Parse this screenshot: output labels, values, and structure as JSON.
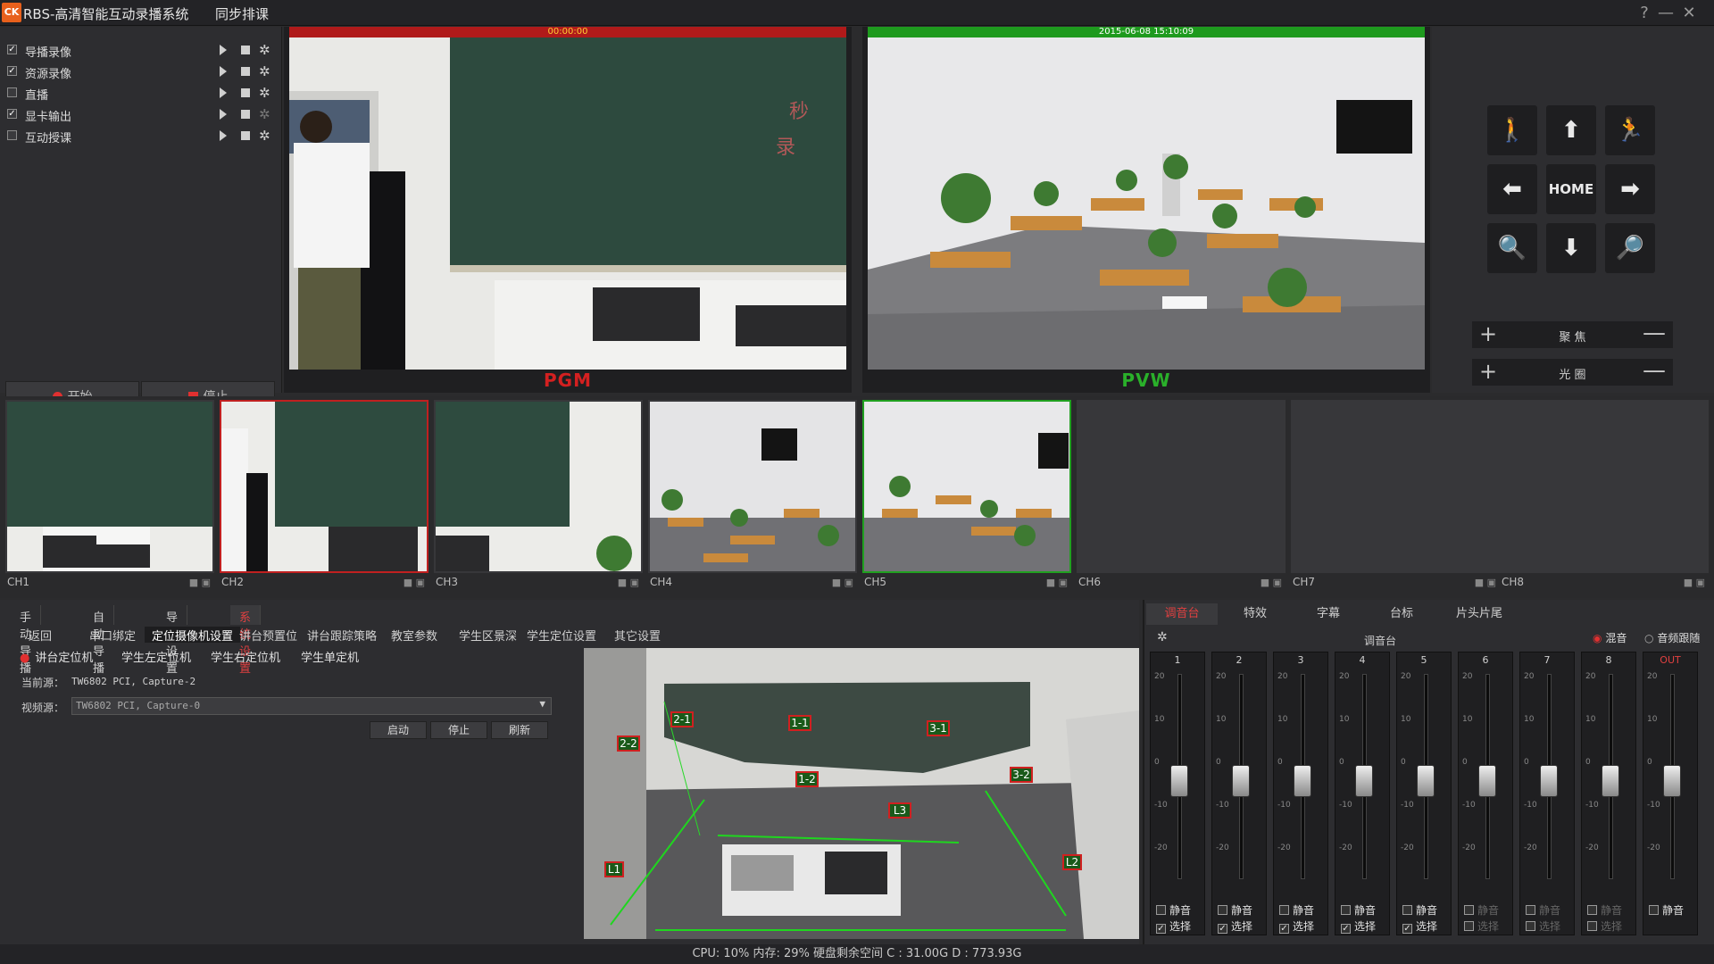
{
  "app": {
    "logo": "CK",
    "title": "RBS-高清智能互动录播系统",
    "menu_sync": "同步排课",
    "help": "?",
    "minimize": "—",
    "close": "✕"
  },
  "recording_panel": {
    "items": [
      {
        "label": "导播录像",
        "checked": true
      },
      {
        "label": "资源录像",
        "checked": true
      },
      {
        "label": "直播",
        "checked": false
      },
      {
        "label": "显卡输出",
        "checked": true
      },
      {
        "label": "互动授课",
        "checked": false
      }
    ],
    "start_label": "开始",
    "stop_label": "停止"
  },
  "pgm": {
    "timecode": "00:00:00",
    "label": "PGM",
    "color": "#cc2020"
  },
  "pvw": {
    "timestamp": "2015-06-08  15:10:09",
    "label": "PVW",
    "color": "#2aa82a"
  },
  "ptz": {
    "home_label": "HOME",
    "focus_label": "聚 焦",
    "iris_label": "光 圈",
    "plus": "+",
    "minus": "—"
  },
  "channels": [
    {
      "name": "CH1",
      "scene": "board"
    },
    {
      "name": "CH2",
      "scene": "teacher",
      "state": "pgm"
    },
    {
      "name": "CH3",
      "scene": "board2"
    },
    {
      "name": "CH4",
      "scene": "room"
    },
    {
      "name": "CH5",
      "scene": "room",
      "state": "pvw"
    },
    {
      "name": "CH6",
      "scene": "empty"
    },
    {
      "name": "CH7",
      "scene": "empty"
    },
    {
      "name": "CH8",
      "scene": "empty"
    }
  ],
  "main_tabs": [
    {
      "label": "手动导播",
      "active": false
    },
    {
      "label": "自动导播",
      "active": false
    },
    {
      "label": "导播设置",
      "active": false
    },
    {
      "label": "系统设置",
      "active": true
    }
  ],
  "sub_tabs": [
    {
      "label": "返回",
      "active": false
    },
    {
      "label": "串口绑定",
      "active": false
    },
    {
      "label": "定位摄像机设置",
      "active": true
    },
    {
      "label": "讲台预置位",
      "active": false
    },
    {
      "label": "讲台跟踪策略",
      "active": false
    },
    {
      "label": "教室参数",
      "active": false
    },
    {
      "label": "学生区景深",
      "active": false
    },
    {
      "label": "学生定位设置",
      "active": false
    },
    {
      "label": "其它设置",
      "active": false
    }
  ],
  "locator": {
    "options": [
      "讲台定位机",
      "学生左定位机",
      "学生右定位机",
      "学生单定机"
    ],
    "current_source_label": "当前源：",
    "current_source_value": "TW6802 PCI, Capture-2",
    "video_source_label": "视频源：",
    "video_source_value": "TW6802 PCI, Capture-0",
    "start_button": "启动",
    "stop_button": "停止",
    "refresh_button": "刷新"
  },
  "zones": [
    "2-1",
    "1-1",
    "3-1",
    "2-2",
    "1-2",
    "3-2",
    "L3",
    "L1",
    "L2"
  ],
  "mixer": {
    "tabs": [
      {
        "label": "调音台",
        "active": true
      },
      {
        "label": "特效",
        "active": false
      },
      {
        "label": "字幕",
        "active": false
      },
      {
        "label": "台标",
        "active": false
      },
      {
        "label": "片头片尾",
        "active": false
      }
    ],
    "title": "调音台",
    "mix_label": "混音",
    "follow_label": "音频跟随",
    "scale": [
      "20",
      "10",
      "0",
      "-10",
      "-20"
    ],
    "mute_label": "静音",
    "select_label": "选择",
    "channels": [
      {
        "num": "1",
        "active": true
      },
      {
        "num": "2",
        "active": true
      },
      {
        "num": "3",
        "active": true
      },
      {
        "num": "4",
        "active": true
      },
      {
        "num": "5",
        "active": true
      },
      {
        "num": "6",
        "active": false
      },
      {
        "num": "7",
        "active": false
      },
      {
        "num": "8",
        "active": false
      },
      {
        "num": "OUT",
        "active": true
      }
    ]
  },
  "status": "CPU: 10% 内存: 29% 硬盘剩余空间   C : 31.00G D : 773.93G"
}
